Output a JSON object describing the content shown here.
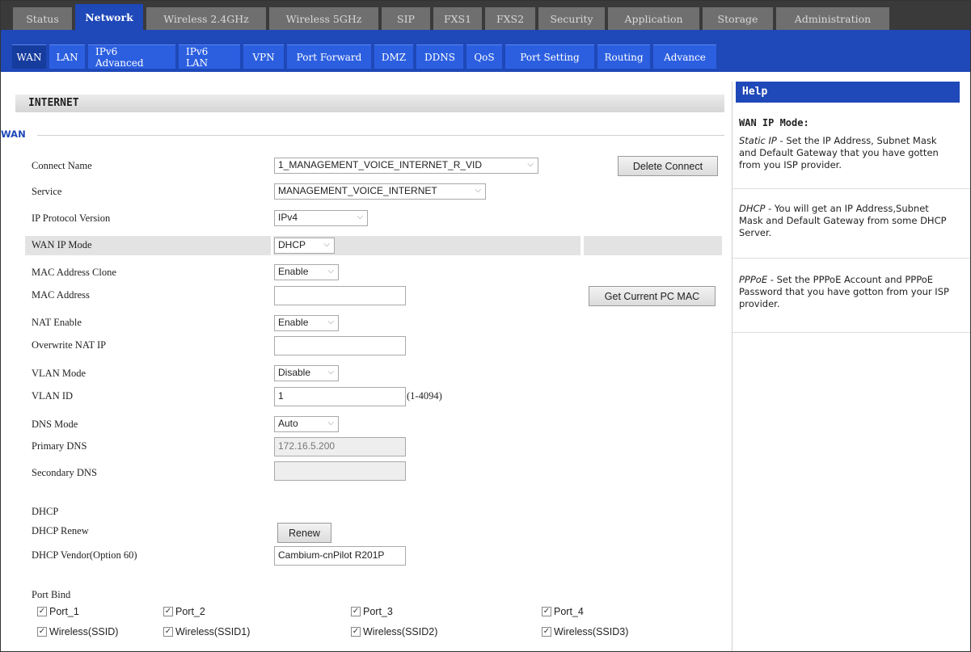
{
  "top_tabs": [
    {
      "label": "Status"
    },
    {
      "label": "Network"
    },
    {
      "label": "Wireless 2.4GHz"
    },
    {
      "label": "Wireless 5GHz"
    },
    {
      "label": "SIP"
    },
    {
      "label": "FXS1"
    },
    {
      "label": "FXS2"
    },
    {
      "label": "Security"
    },
    {
      "label": "Application"
    },
    {
      "label": "Storage"
    },
    {
      "label": "Administration"
    }
  ],
  "top_active": "Network",
  "sub_tabs": [
    {
      "label": "WAN"
    },
    {
      "label": "LAN"
    },
    {
      "label": "IPv6 Advanced"
    },
    {
      "label": "IPv6 LAN"
    },
    {
      "label": "VPN"
    },
    {
      "label": "Port Forward"
    },
    {
      "label": "DMZ"
    },
    {
      "label": "DDNS"
    },
    {
      "label": "QoS"
    },
    {
      "label": "Port Setting"
    },
    {
      "label": "Routing"
    },
    {
      "label": "Advance"
    }
  ],
  "sub_active": "WAN",
  "section": {
    "title": "INTERNET",
    "legend": "WAN"
  },
  "form": {
    "connect_name": {
      "label": "Connect Name",
      "value": "1_MANAGEMENT_VOICE_INTERNET_R_VID",
      "button": "Delete Connect"
    },
    "service": {
      "label": "Service",
      "value": "MANAGEMENT_VOICE_INTERNET"
    },
    "ip_protocol": {
      "label": "IP Protocol Version",
      "value": "IPv4"
    },
    "wan_ip_mode": {
      "label": "WAN IP Mode",
      "value": "DHCP"
    },
    "mac_clone": {
      "label": "MAC Address Clone",
      "value": "Enable"
    },
    "mac_address": {
      "label": "MAC Address",
      "value": "",
      "button": "Get Current PC MAC"
    },
    "nat_enable": {
      "label": "NAT Enable",
      "value": "Enable"
    },
    "overwrite_nat": {
      "label": "Overwrite NAT IP",
      "value": ""
    },
    "vlan_mode": {
      "label": "VLAN Mode",
      "value": "Disable"
    },
    "vlan_id": {
      "label": "VLAN ID",
      "value": "1",
      "hint": "(1-4094)"
    },
    "dns_mode": {
      "label": "DNS Mode",
      "value": "Auto"
    },
    "primary_dns": {
      "label": "Primary DNS",
      "value": "172.16.5.200"
    },
    "secondary_dns": {
      "label": "Secondary DNS",
      "value": ""
    },
    "dhcp": {
      "label": "DHCP"
    },
    "dhcp_renew": {
      "label": "DHCP Renew",
      "button": "Renew"
    },
    "dhcp_vendor": {
      "label": "DHCP Vendor(Option 60)",
      "value": "Cambium-cnPilot R201P"
    },
    "port_bind": {
      "label": "Port Bind",
      "ports": [
        "Port_1",
        "Port_2",
        "Port_3",
        "Port_4"
      ],
      "wireless": [
        "Wireless(SSID)",
        "Wireless(SSID1)",
        "Wireless(SSID2)",
        "Wireless(SSID3)"
      ],
      "check_glyph": "✓"
    }
  },
  "help": {
    "header": "Help",
    "title": "WAN IP Mode:",
    "items": [
      {
        "term": "Static IP",
        "text": " - Set the IP Address, Subnet Mask and Default Gateway that you have gotten from you ISP provider."
      },
      {
        "term": "DHCP",
        "text": " - You will get an IP Address,Subnet Mask and Default Gateway from some DHCP Server."
      },
      {
        "term": "PPPoE",
        "text": " - Set the PPPoE Account and PPPoE Password that you have gotton from your ISP provider."
      }
    ]
  },
  "icons": {
    "chevron": "chevron-down-icon",
    "check": "checkmark-icon"
  },
  "colors": {
    "accent": "#1f48b8",
    "topbar": "#3a3a3a",
    "tab_inactive": "#6f6f6f",
    "subtab": "#2c5fe0"
  }
}
